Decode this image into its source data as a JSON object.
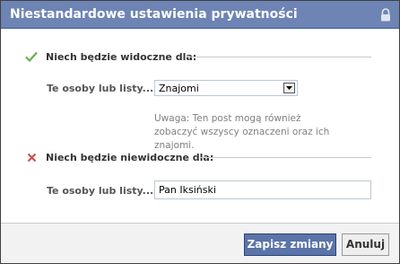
{
  "dialog": {
    "title": "Niestandardowe ustawienia prywatności",
    "title_icon": "lock-icon"
  },
  "visible_section": {
    "heading": "Niech będzie widoczne dla:",
    "icon": "check-icon",
    "field_label": "Te osoby lub listy...:",
    "selected_value": "Znajomi",
    "note": "Uwaga: Ten post mogą również zobaczyć wszyscy oznaczeni oraz ich znajomi."
  },
  "hidden_section": {
    "heading": "Niech będzie niewidoczne dla:",
    "icon": "cross-icon",
    "field_label": "Te osoby lub listy...:",
    "input_value": "Pan Iksiński"
  },
  "footer": {
    "save_label": "Zapisz zmiany",
    "cancel_label": "Anuluj"
  },
  "colors": {
    "titlebar": "#6d84b4",
    "primary_button": "#5b74a8",
    "check": "#6ab04c",
    "cross": "#d05050"
  }
}
